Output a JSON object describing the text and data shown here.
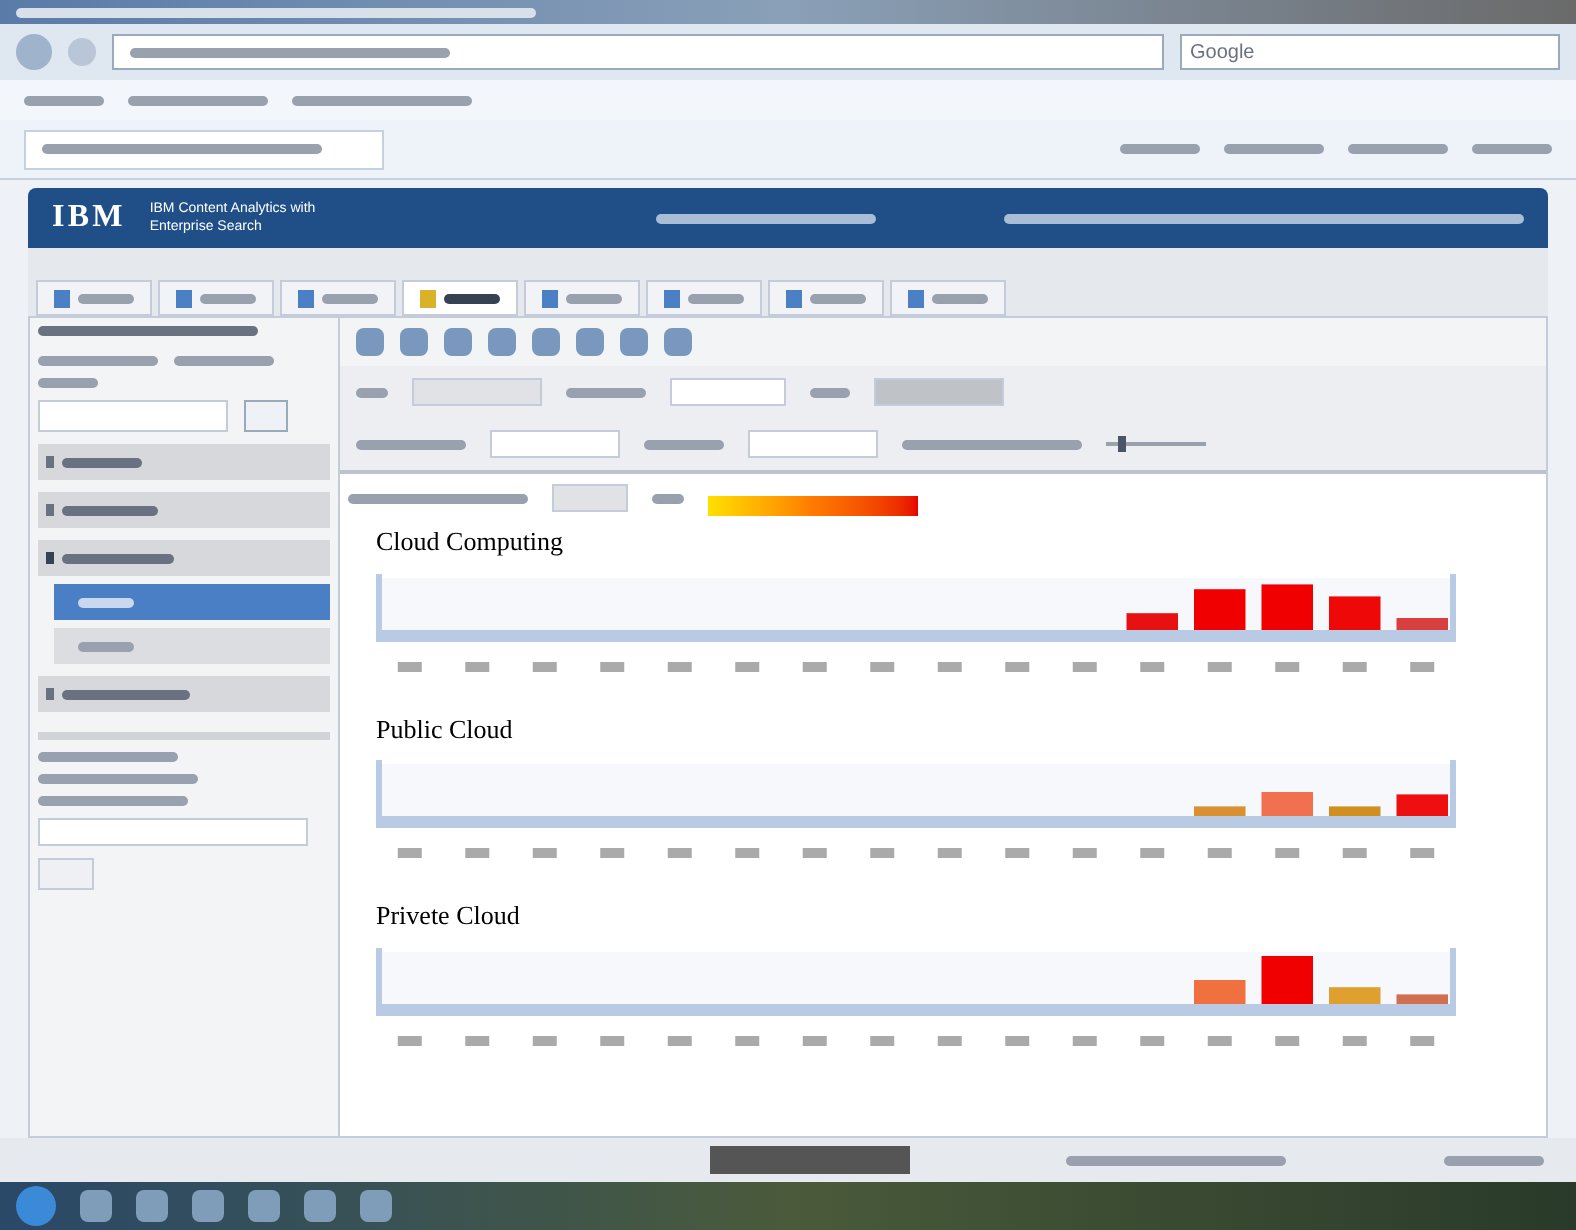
{
  "browser": {
    "search_placeholder": "Google"
  },
  "app_header": {
    "logo": "IBM",
    "product_name": [
      "IBM Content Analytics with",
      "Enterprise Search"
    ]
  },
  "tabs": [
    {
      "selected": false
    },
    {
      "selected": false
    },
    {
      "selected": false
    },
    {
      "selected": true
    },
    {
      "selected": false
    },
    {
      "selected": false
    },
    {
      "selected": false
    },
    {
      "selected": false
    }
  ],
  "sidebar": {
    "facets": [
      {
        "expanded": false
      },
      {
        "expanded": false
      },
      {
        "expanded": true,
        "children": [
          {
            "selected": true
          },
          {
            "selected": false
          }
        ]
      },
      {
        "expanded": false
      }
    ]
  },
  "toolbar": {
    "zoom_slider": {
      "level": 0.12
    }
  },
  "charts": [
    {
      "title": "Cloud Computing"
    },
    {
      "title": "Public Cloud"
    },
    {
      "title": "Privete Cloud"
    }
  ]
}
